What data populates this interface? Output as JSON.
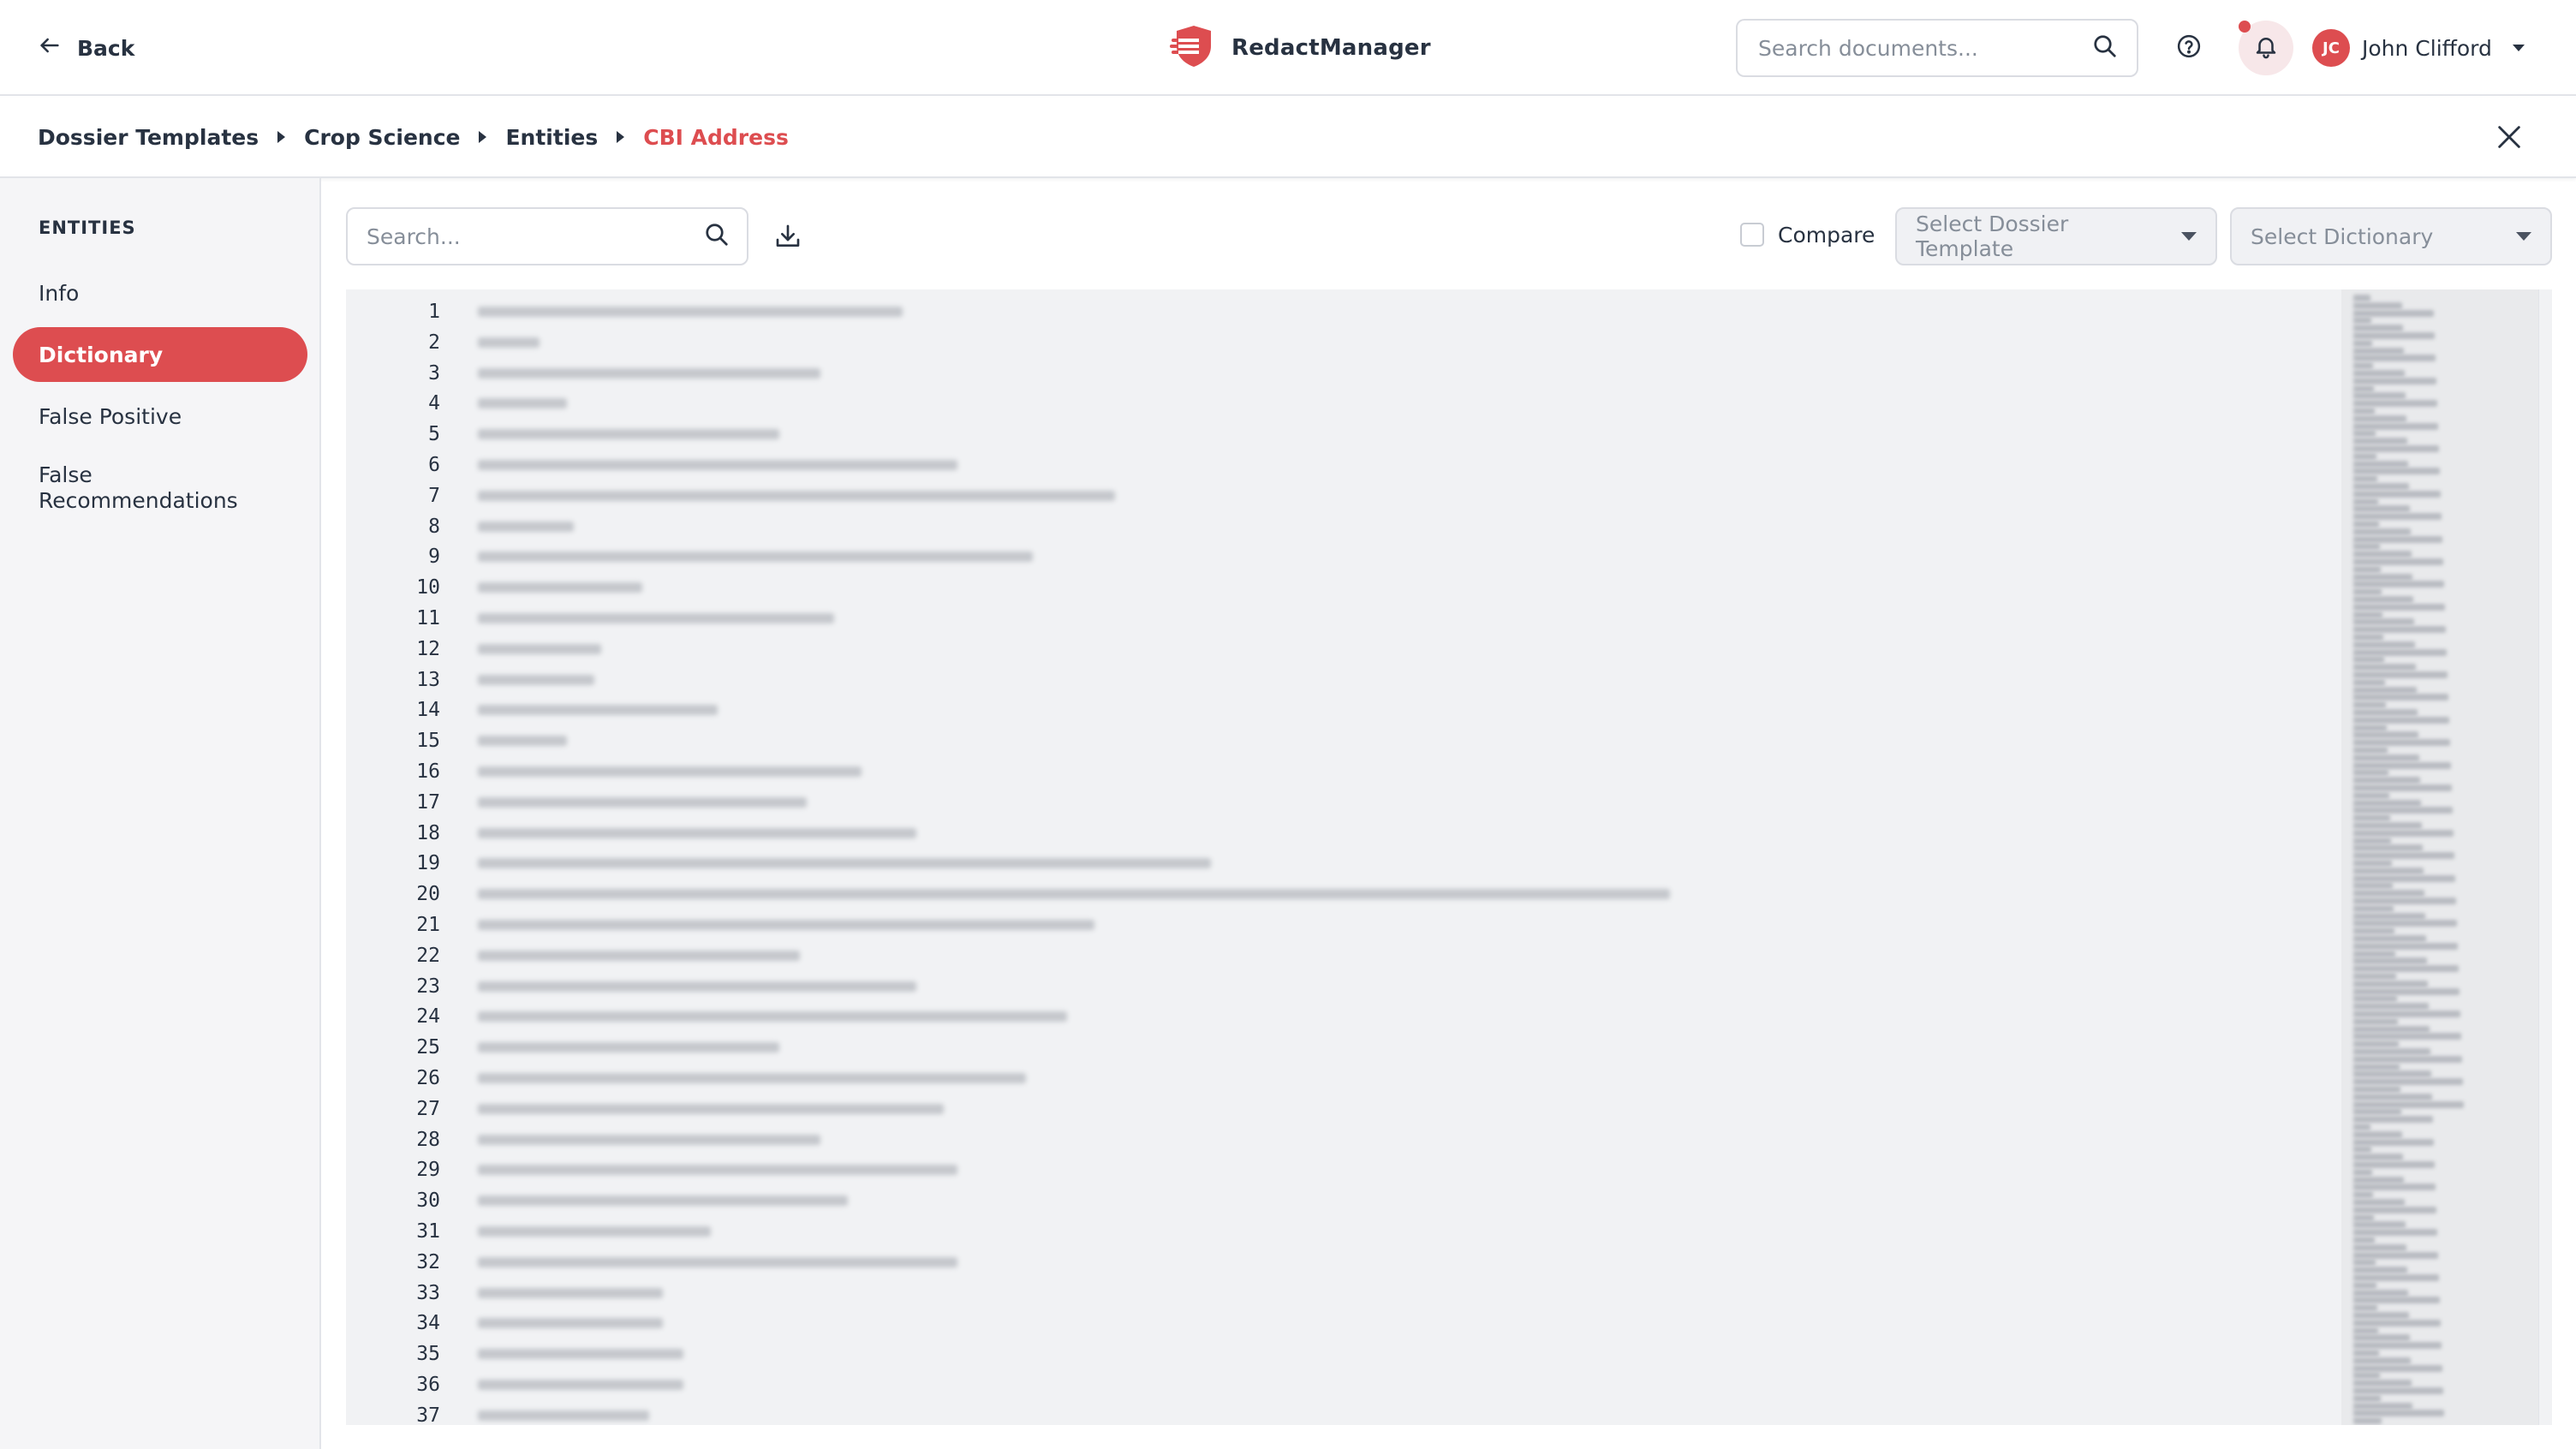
{
  "header": {
    "back_label": "Back",
    "app_name": "RedactManager",
    "search_placeholder": "Search documents...",
    "user": {
      "initials": "JC",
      "name": "John Clifford"
    },
    "has_notification": true
  },
  "breadcrumb": {
    "items": [
      "Dossier Templates",
      "Crop Science",
      "Entities"
    ],
    "active": "CBI Address"
  },
  "sidebar": {
    "title": "ENTITIES",
    "items": [
      {
        "label": "Info"
      },
      {
        "label": "Dictionary",
        "active": true
      },
      {
        "label": "False Positive"
      },
      {
        "label": "False Recommendations"
      }
    ]
  },
  "toolbar": {
    "search_placeholder": "Search...",
    "compare_label": "Compare",
    "compare_checked": false,
    "select_template_placeholder": "Select Dossier Template",
    "select_dictionary_placeholder": "Select Dictionary"
  },
  "editor": {
    "line_numbers": [
      "1",
      "2",
      "3",
      "4",
      "5",
      "6",
      "7",
      "8",
      "9",
      "10",
      "11",
      "12",
      "13",
      "14",
      "15",
      "16",
      "17",
      "18",
      "19",
      "20",
      "21",
      "22",
      "23",
      "24",
      "25",
      "26",
      "27",
      "28",
      "29",
      "30",
      "31",
      "32",
      "33",
      "34",
      "35",
      "36",
      "37"
    ],
    "content_blurred": true
  },
  "colors": {
    "accent": "#dd4d50",
    "text": "#283241",
    "editor_bg": "#f1f2f4"
  }
}
